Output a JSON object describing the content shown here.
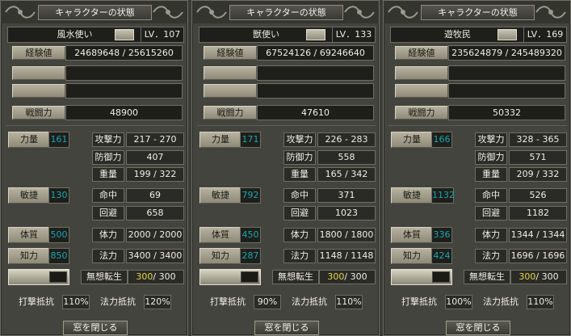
{
  "window_title": "キャラクターの状態",
  "labels": {
    "exp": "経験値",
    "battle_power": "戦闘力",
    "strength": "力量",
    "agility": "敏捷",
    "vitality": "体質",
    "intellect": "知力",
    "attack": "攻撃力",
    "defense": "防御力",
    "weight": "重量",
    "hit": "命中",
    "evade": "回避",
    "hp": "体力",
    "mp": "法力",
    "mugen": "無想転生",
    "strike_resist": "打撃抵抗",
    "magic_resist": "法力抵抗",
    "close": "窓を閉じる"
  },
  "characters": [
    {
      "name": "風水使い",
      "level": "LV．107",
      "exp": "24689648 / 25615260",
      "battle_power": "48900",
      "strength": "161",
      "agility": "130",
      "vitality": "500",
      "intellect": "850",
      "attack": "217 - 270",
      "defense": "407",
      "weight": "199 / 322",
      "hit": "69",
      "evade": "658",
      "hp": "2000 / 2000",
      "mp": "3400 / 3400",
      "mugen_cur": "300",
      "mugen_max": "/ 300",
      "strike_resist": "110%",
      "magic_resist": "120%"
    },
    {
      "name": "獣使い",
      "level": "LV．133",
      "exp": "67524126 / 69246640",
      "battle_power": "47610",
      "strength": "171",
      "agility": "792",
      "vitality": "450",
      "intellect": "287",
      "attack": "226 - 283",
      "defense": "558",
      "weight": "165 / 342",
      "hit": "371",
      "evade": "1023",
      "hp": "1800 / 1800",
      "mp": "1148 / 1148",
      "mugen_cur": "300",
      "mugen_max": "/ 300",
      "strike_resist": "90%",
      "magic_resist": "110%"
    },
    {
      "name": "遊牧民",
      "level": "LV．169",
      "exp": "235624879 / 245489320",
      "battle_power": "50332",
      "strength": "166",
      "agility": "1132",
      "vitality": "336",
      "intellect": "424",
      "attack": "328 - 365",
      "defense": "571",
      "weight": "209 / 332",
      "hit": "526",
      "evade": "1182",
      "hp": "1344 / 1344",
      "mp": "1696 / 1696",
      "mugen_cur": "300",
      "mugen_max": "/ 300",
      "strike_resist": "100%",
      "magic_resist": "110%"
    }
  ]
}
